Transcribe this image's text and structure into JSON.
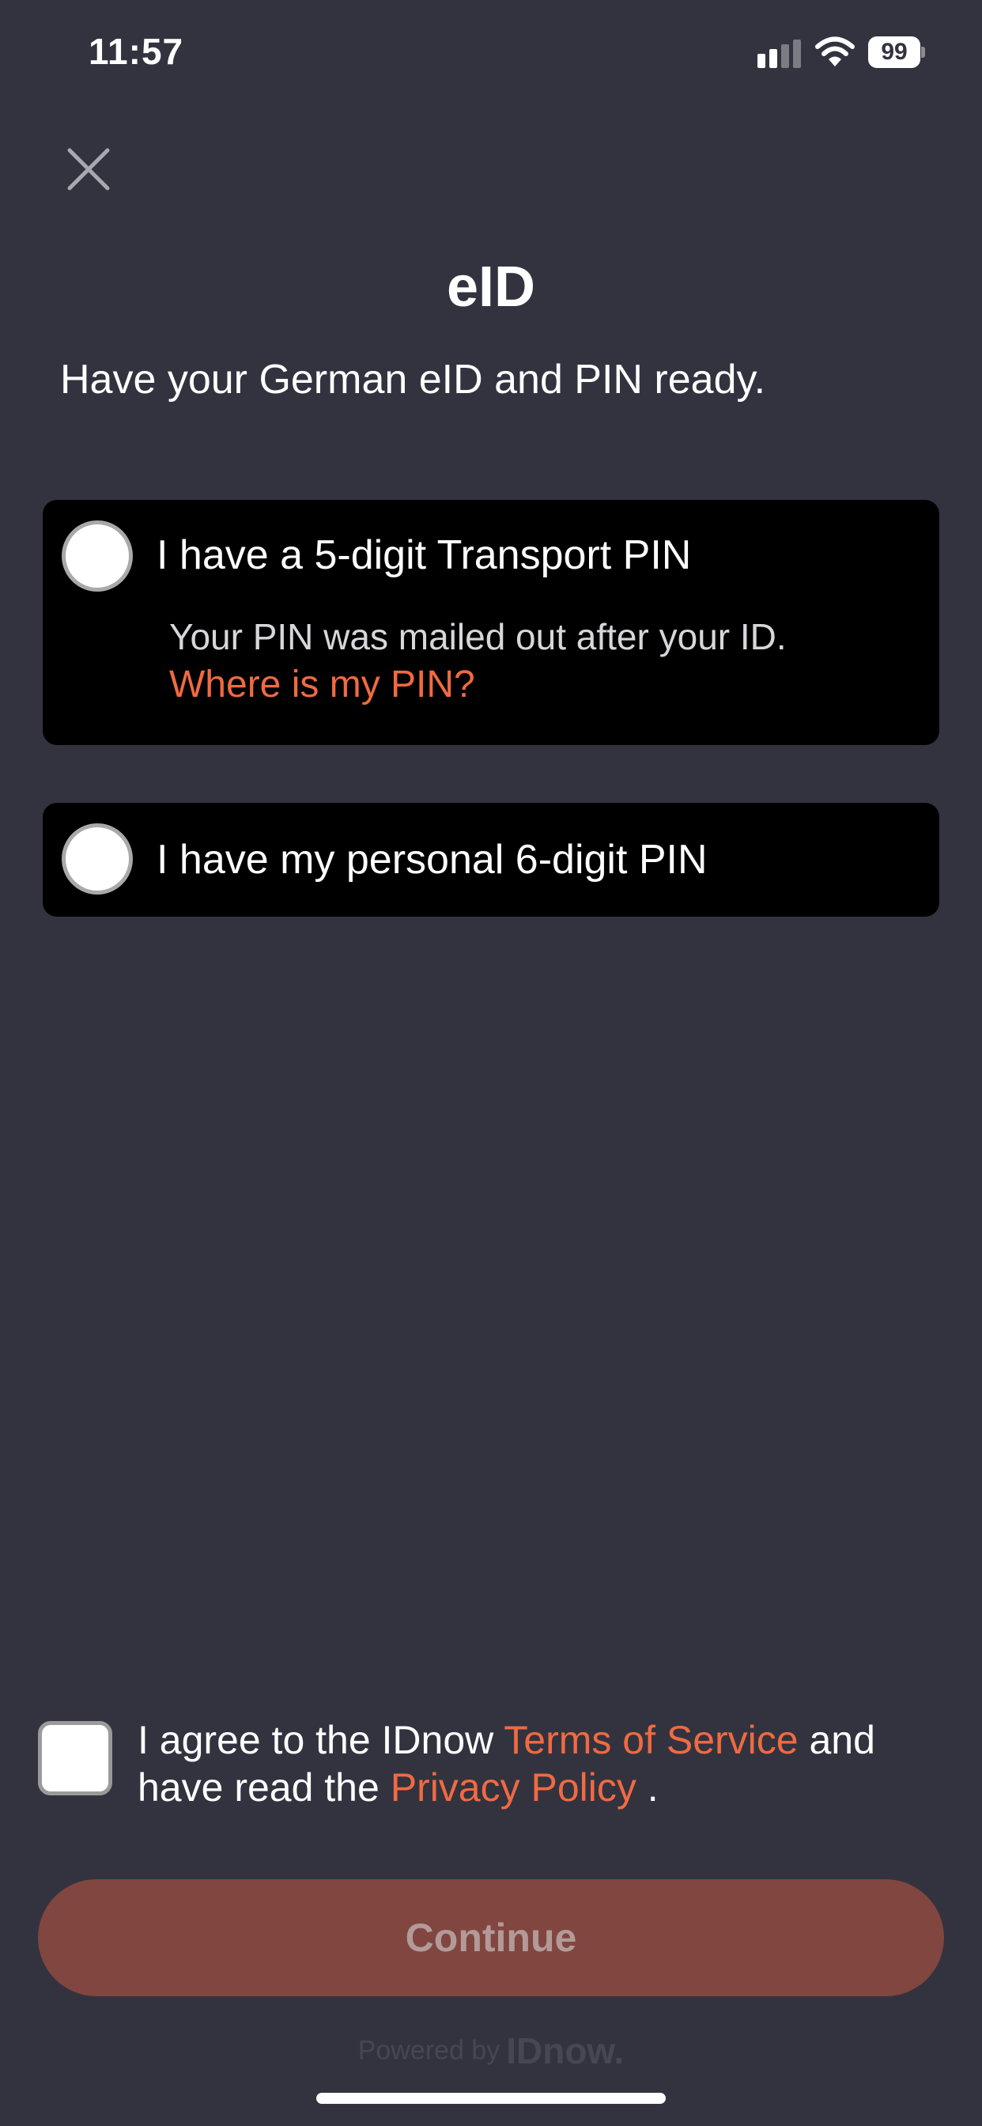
{
  "status_bar": {
    "time": "11:57",
    "battery": "99"
  },
  "header": {
    "title": "eID",
    "instruction": "Have your German eID and PIN ready."
  },
  "options": [
    {
      "label": "I have a 5-digit Transport PIN",
      "description": "Your PIN was mailed out after your ID.",
      "link": "Where is my PIN?"
    },
    {
      "label": "I have my personal 6-digit PIN"
    }
  ],
  "agreement": {
    "text_1": "I agree to the IDnow ",
    "terms_link": "Terms of Service",
    "text_2": " and have read the ",
    "privacy_link": "Privacy Policy",
    "text_3": " ."
  },
  "continue_label": "Continue",
  "footer": {
    "powered_by": "Powered by",
    "brand": "IDnow."
  },
  "colors": {
    "background": "#32333f",
    "card": "#000000",
    "accent": "#f06a42",
    "button_disabled": "#80463f"
  },
  "icons": [
    "signal-icon",
    "wifi-icon",
    "battery-icon",
    "close-icon"
  ]
}
